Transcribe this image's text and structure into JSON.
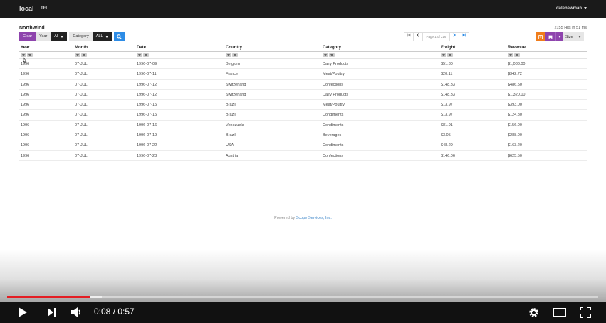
{
  "navbar": {
    "brand": "local",
    "link": "TFL",
    "user": "dalenewman"
  },
  "header": {
    "title": "NorthWind",
    "hits": "2155 Hits in 51 ms"
  },
  "toolbar": {
    "clear_label": "Clear",
    "year_label": "Year",
    "year_value": "All",
    "category_label": "Category",
    "category_value": "ALL",
    "search_icon": "search-icon"
  },
  "pager": {
    "info": "Page 1 of 216"
  },
  "tools": {
    "size_label": "Size"
  },
  "table": {
    "columns": [
      "Year",
      "Month",
      "Date",
      "Country",
      "Category",
      "Freight",
      "Revenue"
    ],
    "rows": [
      [
        "1996",
        "07-JUL",
        "1996-07-09",
        "Belgium",
        "Dairy Products",
        "$51.30",
        "$1,088.00"
      ],
      [
        "1996",
        "07-JUL",
        "1996-07-11",
        "France",
        "Meat/Poultry",
        "$20.11",
        "$342.72"
      ],
      [
        "1996",
        "07-JUL",
        "1996-07-12",
        "Switzerland",
        "Confections",
        "$148.33",
        "$486.50"
      ],
      [
        "1996",
        "07-JUL",
        "1996-07-12",
        "Switzerland",
        "Dairy Products",
        "$148.33",
        "$1,320.00"
      ],
      [
        "1996",
        "07-JUL",
        "1996-07-15",
        "Brazil",
        "Meat/Poultry",
        "$13.97",
        "$393.00"
      ],
      [
        "1996",
        "07-JUL",
        "1996-07-15",
        "Brazil",
        "Condiments",
        "$13.97",
        "$124.80"
      ],
      [
        "1996",
        "07-JUL",
        "1996-07-16",
        "Venezuela",
        "Condiments",
        "$81.91",
        "$156.00"
      ],
      [
        "1996",
        "07-JUL",
        "1996-07-19",
        "Brazil",
        "Beverages",
        "$3.05",
        "$288.00"
      ],
      [
        "1996",
        "07-JUL",
        "1996-07-22",
        "USA",
        "Condiments",
        "$48.29",
        "$163.20"
      ],
      [
        "1996",
        "07-JUL",
        "1996-07-23",
        "Austria",
        "Confections",
        "$146.06",
        "$625.50"
      ]
    ]
  },
  "footer": {
    "powered_prefix": "Powered by",
    "powered_link": "Scope Services, Inc."
  },
  "player": {
    "time": "0:08 / 0:57",
    "progress_fraction": 0.14,
    "buffered_fraction": 0.16,
    "colors": {
      "progress": "#e31e24"
    }
  }
}
